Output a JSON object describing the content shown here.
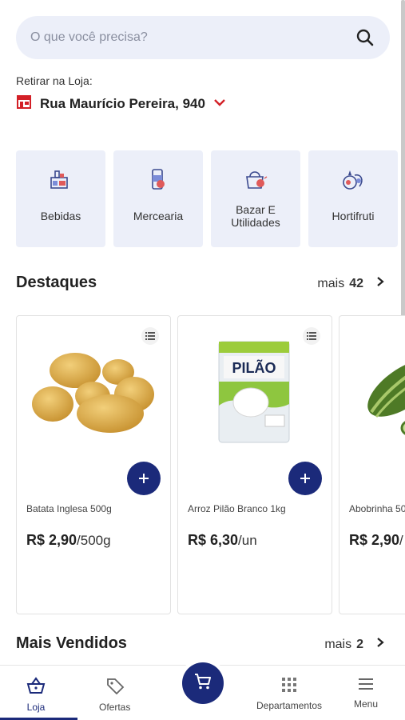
{
  "search": {
    "placeholder": "O que você precisa?"
  },
  "store": {
    "label": "Retirar na Loja:",
    "name": "Rua Maurício Pereira, 940",
    "accent": "#d32027"
  },
  "categories": [
    {
      "label": "Bebidas",
      "icon": "drinks-icon"
    },
    {
      "label": "Mercearia",
      "icon": "grocery-icon"
    },
    {
      "label": "Bazar E Utilidades",
      "icon": "bazaar-icon"
    },
    {
      "label": "Hortifruti",
      "icon": "produce-icon"
    }
  ],
  "destaques": {
    "title": "Destaques",
    "more_label": "mais",
    "more_count": "42"
  },
  "products": [
    {
      "name": "Batata Inglesa 500g",
      "price": "R$ 2,90",
      "unit": "/500g",
      "image": "potatoes-image"
    },
    {
      "name": "Arroz Pilão Branco 1kg",
      "price": "R$ 6,30",
      "unit": "/un",
      "image": "rice-bag-image"
    },
    {
      "name": "Abobrinha 50",
      "price": "R$ 2,90",
      "unit": "/",
      "image": "zucchini-image"
    }
  ],
  "mais_vendidos": {
    "title": "Mais Vendidos",
    "more_label": "mais",
    "more_count": "2"
  },
  "nav": {
    "loja": "Loja",
    "ofertas": "Ofertas",
    "departamentos": "Departamentos",
    "menu": "Menu"
  },
  "colors": {
    "primary": "#1b2a7a",
    "card_bg": "#eceff9",
    "store_red": "#d32027"
  },
  "rice_brand": "PILÃO"
}
